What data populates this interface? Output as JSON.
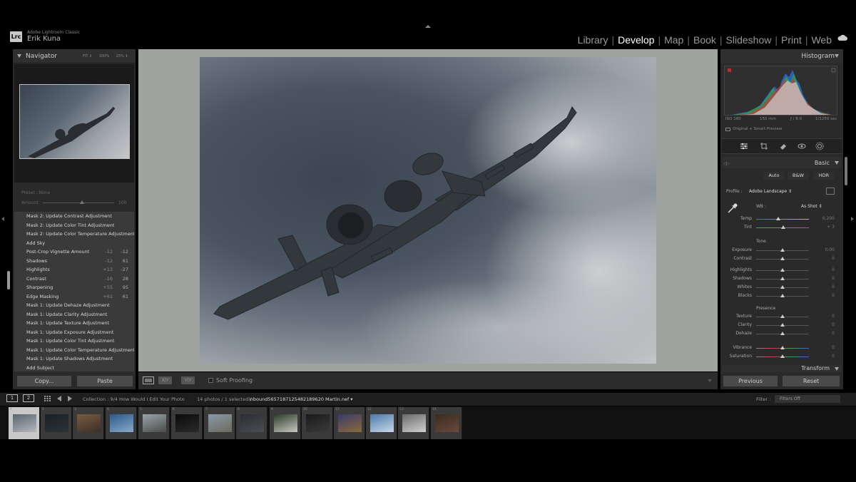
{
  "app": {
    "name": "Adobe Lightroom Classic",
    "logo_text": "Lrc",
    "user": "Erik Kuna"
  },
  "modules": [
    "Library",
    "Develop",
    "Map",
    "Book",
    "Slideshow",
    "Print",
    "Web"
  ],
  "active_module": "Develop",
  "navigator": {
    "title": "Navigator",
    "zoom_options": [
      "FIT ⇕",
      "100%",
      "25% ⇕"
    ]
  },
  "snapshot": {
    "label": "Preset : None",
    "amount_label": "Amount",
    "amount_value": "100",
    "amount_level": 0.55
  },
  "history": [
    {
      "label": "Mask 2: Update Contrast Adjustment",
      "from": "",
      "to": ""
    },
    {
      "label": "Mask 2: Update Color Tint Adjustment",
      "from": "",
      "to": ""
    },
    {
      "label": "Mask 2: Update Color Temperature Adjustment",
      "from": "",
      "to": ""
    },
    {
      "label": "Add Sky",
      "from": "",
      "to": ""
    },
    {
      "label": "Post-Crop Vignette Amount",
      "from": "-12",
      "to": "-12"
    },
    {
      "label": "Shadows",
      "from": "-12",
      "to": "61"
    },
    {
      "label": "Highlights",
      "from": "+13",
      "to": "-27"
    },
    {
      "label": "Contrast",
      "from": "-16",
      "to": "28"
    },
    {
      "label": "Sharpening",
      "from": "+55",
      "to": "95"
    },
    {
      "label": "Edge Masking",
      "from": "+61",
      "to": "61"
    },
    {
      "label": "Mask 1: Update Dehaze Adjustment",
      "from": "",
      "to": ""
    },
    {
      "label": "Mask 1: Update Clarity Adjustment",
      "from": "",
      "to": ""
    },
    {
      "label": "Mask 1: Update Texture Adjustment",
      "from": "",
      "to": ""
    },
    {
      "label": "Mask 1: Update Exposure Adjustment",
      "from": "",
      "to": ""
    },
    {
      "label": "Mask 1: Update Color Tint Adjustment",
      "from": "",
      "to": ""
    },
    {
      "label": "Mask 1: Update Color Temperature Adjustment",
      "from": "",
      "to": ""
    },
    {
      "label": "Mask 1: Update Shadows Adjustment",
      "from": "",
      "to": ""
    },
    {
      "label": "Add Subject",
      "from": "",
      "to": ""
    }
  ],
  "left_buttons": {
    "copy": "Copy...",
    "paste": "Paste"
  },
  "toolbar": {
    "softproof": "Soft Proofing",
    "compare_label": "X|Y",
    "yy_label": "Y|Y"
  },
  "histogram": {
    "title": "Histogram",
    "iso": "ISO 160",
    "focal": "150 mm",
    "aperture": "ƒ / 8.0",
    "shutter": "1/1250 sec",
    "preview_status": "Original + Smart Preview"
  },
  "basic": {
    "title": "Basic",
    "treatments": [
      "Auto",
      "B&W",
      "HDR"
    ],
    "profile_label": "Profile :",
    "profile_value": "Adobe Landscape ⇕",
    "wb_label": "WB :",
    "wb_value": "As Shot ⇕",
    "sections": {
      "tone": "Tone",
      "presence": "Presence"
    },
    "wb_sliders": [
      {
        "label": "Temp",
        "value": "6,200",
        "pos": 0.42
      },
      {
        "label": "Tint",
        "value": "+ 3",
        "pos": 0.52
      }
    ],
    "tone_sliders": [
      {
        "label": "Exposure",
        "value": "0.00",
        "pos": 0.5
      },
      {
        "label": "Contrast",
        "value": "0",
        "pos": 0.5
      },
      {
        "label": "Highlights",
        "value": "0",
        "pos": 0.5
      },
      {
        "label": "Shadows",
        "value": "0",
        "pos": 0.5
      },
      {
        "label": "Whites",
        "value": "0",
        "pos": 0.5
      },
      {
        "label": "Blacks",
        "value": "0",
        "pos": 0.5
      }
    ],
    "presence_sliders": [
      {
        "label": "Texture",
        "value": "0",
        "pos": 0.5
      },
      {
        "label": "Clarity",
        "value": "0",
        "pos": 0.5
      },
      {
        "label": "Dehaze",
        "value": "0",
        "pos": 0.5
      },
      {
        "label": "Vibrance",
        "value": "0",
        "pos": 0.5
      },
      {
        "label": "Saturation",
        "value": "0",
        "pos": 0.5
      }
    ]
  },
  "transform_title": "Transform",
  "right_buttons": {
    "previous": "Previous",
    "reset": "Reset"
  },
  "filmbar": {
    "screen1": "1",
    "screen2": "2",
    "collection": "Collection : 9/4 How Would I Edit Your Photo",
    "count": "14 photos / 1 selected /",
    "filename": "inbound5657187125482189620 Martin.nef ▾",
    "filter_label": "Filter :",
    "filter_value": "Filters Off"
  },
  "filmstrip": [
    {
      "num": "1",
      "colors": [
        "#5a6470",
        "#b4b8bc"
      ]
    },
    {
      "num": "2",
      "colors": [
        "#1a2024",
        "#2c3438"
      ]
    },
    {
      "num": "3",
      "colors": [
        "#7a5a40",
        "#3a3028"
      ]
    },
    {
      "num": "4",
      "colors": [
        "#2a5a8a",
        "#8aa8c8"
      ]
    },
    {
      "num": "5",
      "colors": [
        "#9aa4aa",
        "#4a4c48"
      ]
    },
    {
      "num": "6",
      "colors": [
        "#0a0a0a",
        "#2a2a2a"
      ]
    },
    {
      "num": "7",
      "colors": [
        "#8a9aaa",
        "#6a6a5a"
      ]
    },
    {
      "num": "8",
      "colors": [
        "#2a2e34",
        "#4a4e54"
      ]
    },
    {
      "num": "9",
      "colors": [
        "#2a3a2a",
        "#c8c8c0"
      ]
    },
    {
      "num": "10",
      "colors": [
        "#1a1a1a",
        "#3a3a3a"
      ]
    },
    {
      "num": "11",
      "colors": [
        "#3a3a6a",
        "#8a6a3a"
      ]
    },
    {
      "num": "12",
      "colors": [
        "#4a7aaa",
        "#c8d8e8"
      ]
    },
    {
      "num": "13",
      "colors": [
        "#6a6a6a",
        "#d0d0d0"
      ]
    },
    {
      "num": "14",
      "colors": [
        "#3a2a20",
        "#6a4a3a"
      ]
    }
  ],
  "selected_film_index": 0
}
